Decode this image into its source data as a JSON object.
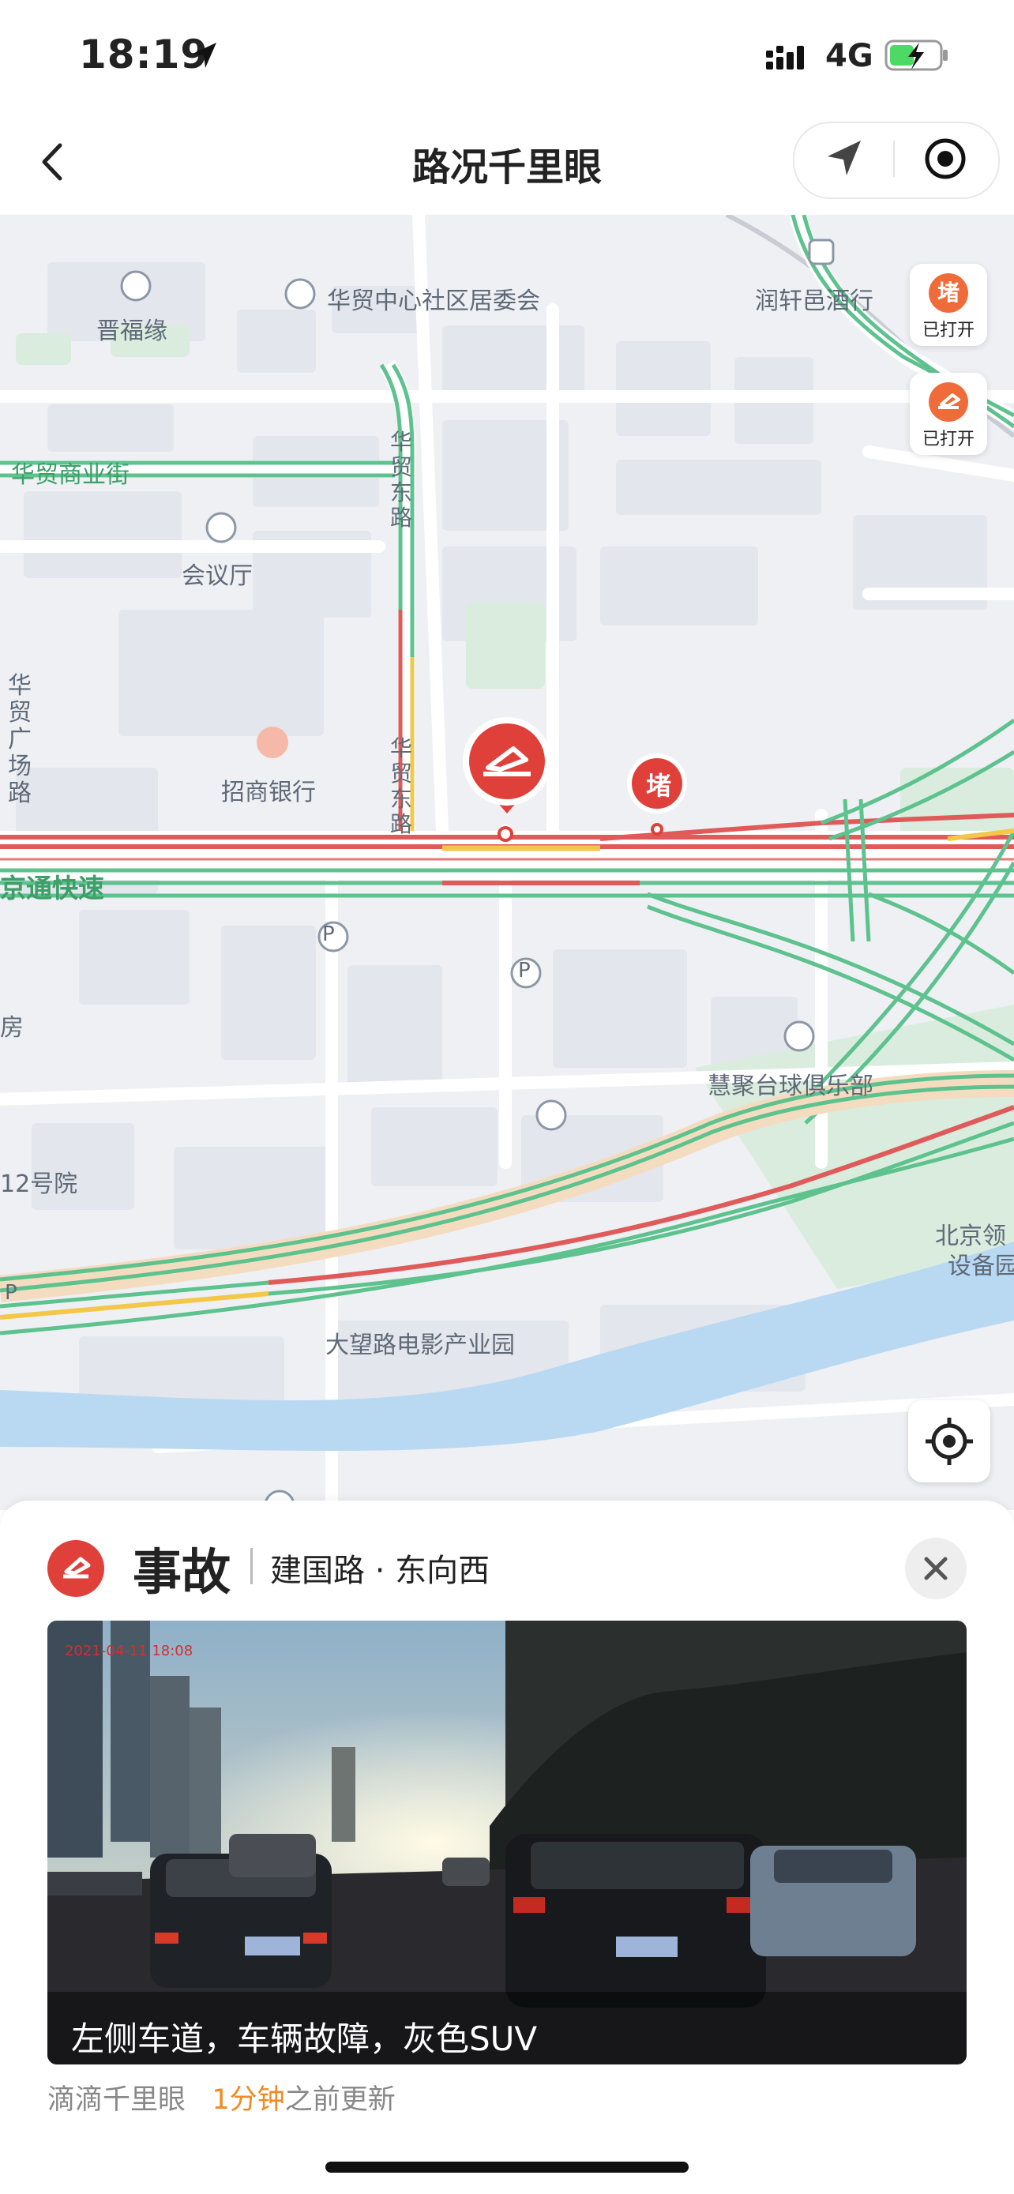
{
  "status_bar": {
    "time": "18:19",
    "network": "4G"
  },
  "nav": {
    "title": "路况千里眼"
  },
  "map": {
    "labels": {
      "jinfuyuan": "晋福缘",
      "community": "华贸中心社区居委会",
      "runxuan": "润轩邑酒行",
      "huamao_street": "华贸商业街",
      "huamao_east_1": "华贸东路",
      "huamao_east_2": "华贸东路",
      "meeting_hall": "会议厅",
      "huamao_square": "华贸广场路",
      "cmb": "招商银行",
      "jingtong": "京通快速",
      "huiju": "慧聚台球俱乐部",
      "no12": "12号院",
      "beijing_ling": "北京领",
      "shebei": "设备园",
      "dawang": "大望路电影产业园",
      "fang": "房",
      "parking_1": "P",
      "parking_2": "P",
      "parking_3": "P"
    },
    "markers": {
      "jam_text": "堵"
    },
    "toggles": [
      {
        "icon_text": "堵",
        "label": "已打开"
      },
      {
        "icon_text": "",
        "label": "已打开"
      }
    ],
    "colors": {
      "smooth": "#5ec28e",
      "slow": "#f3c748",
      "jam": "#e05a5a",
      "water": "#b9d9f3",
      "green_area": "#d9ecdd",
      "base": "#eef0f4"
    }
  },
  "sheet": {
    "type": "事故",
    "road": "建国路 · 东向西",
    "caption": "左侧车道，车辆故障，灰色SUV",
    "photo_stamp": "2021-04-11 18:08",
    "source": "滴滴千里眼",
    "updated_value": "1分钟",
    "updated_suffix": "之前更新"
  }
}
